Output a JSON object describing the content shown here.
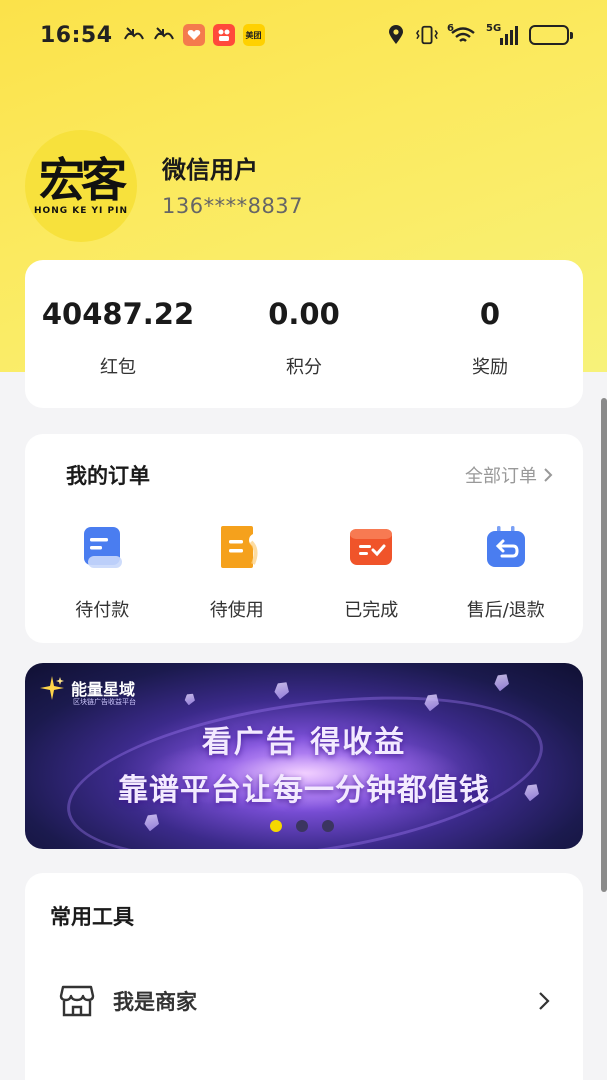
{
  "status_bar": {
    "time": "16:54",
    "left_icons": [
      "missed-call-icon",
      "missed-call-icon",
      "health-app-icon",
      "kuaishou-app-icon",
      "meituan-app-icon"
    ],
    "meituan_label": "美团",
    "right_icons": [
      "location-icon",
      "vibrate-icon",
      "wifi-icon",
      "signal-icon",
      "battery-icon"
    ],
    "wifi_label": "6",
    "network_label": "5G",
    "battery_color": "#f2a31b"
  },
  "profile": {
    "logo_text": "宏客",
    "logo_subtext": "HONG KE YI PIN",
    "username": "微信用户",
    "phone": "136****8837"
  },
  "stats": [
    {
      "value": "40487.22",
      "label": "红包"
    },
    {
      "value": "0.00",
      "label": "积分"
    },
    {
      "value": "0",
      "label": "奖励"
    }
  ],
  "orders": {
    "title": "我的订单",
    "all_label": "全部订单",
    "items": [
      {
        "label": "待付款",
        "icon": "pending-payment-icon",
        "color": "#4a7df0"
      },
      {
        "label": "待使用",
        "icon": "pending-use-icon",
        "color": "#f5a11c"
      },
      {
        "label": "已完成",
        "icon": "completed-icon",
        "color": "#f0542a"
      },
      {
        "label": "售后/退款",
        "icon": "refund-icon",
        "color": "#4a7df0"
      }
    ]
  },
  "banner": {
    "brand_name": "能量星域",
    "brand_sub": "区块链广告收益平台",
    "line1": "看广告 得收益",
    "line2": "靠谱平台让每一分钟都值钱",
    "active_dot": 0,
    "dot_count": 3
  },
  "tools": {
    "title": "常用工具",
    "items": [
      {
        "label": "我是商家",
        "icon": "store-icon"
      }
    ]
  },
  "colors": {
    "accent_yellow": "#fbe24a",
    "page_bg": "#f4f4f6"
  }
}
